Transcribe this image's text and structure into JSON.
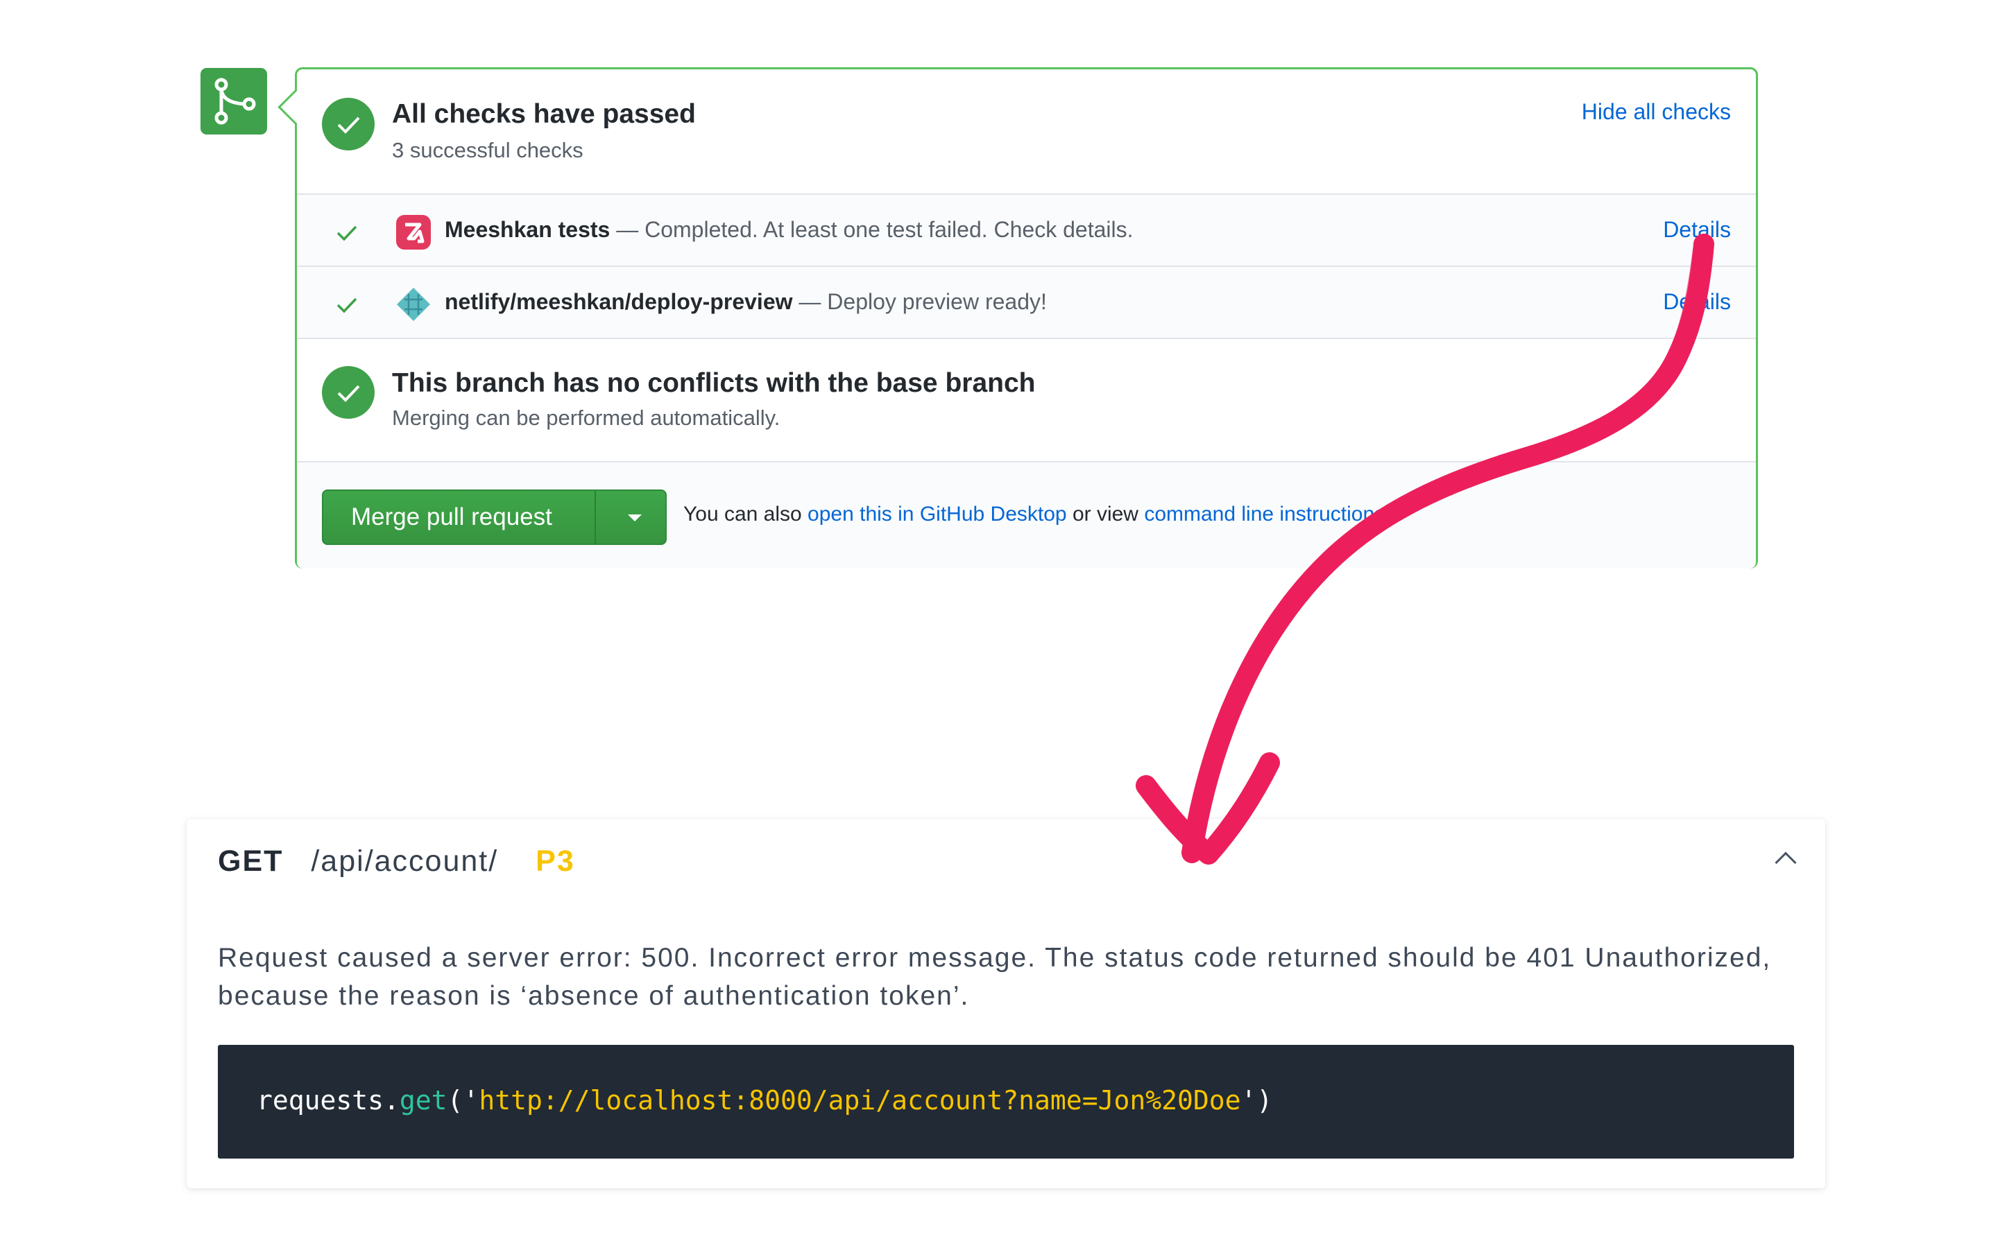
{
  "status_header": {
    "title": "All checks have passed",
    "subtitle": "3 successful checks",
    "hide_link": "Hide all checks"
  },
  "checks": [
    {
      "name": "Meeshkan tests",
      "description": "— Completed. At least one test failed. Check details.",
      "details_label": "Details",
      "logo_icon": "meeshkan-logo-icon"
    },
    {
      "name": "netlify/meeshkan/deploy-preview",
      "description": "— Deploy preview ready!",
      "details_label": "Details",
      "logo_icon": "netlify-logo-icon"
    }
  ],
  "conflicts": {
    "title": "This branch has no conflicts with the base branch",
    "subtitle": "Merging can be performed automatically."
  },
  "merge": {
    "button_label": "Merge pull request",
    "hint_prefix": "You can also",
    "desktop_link": "open this in GitHub Desktop",
    "hint_middle": "or view",
    "cli_link": "command line instructions."
  },
  "report_card": {
    "method": "GET",
    "path": "/api/account/",
    "priority": "P3",
    "description": "Request caused a server error: 500. Incorrect error message. The status code returned should be 401 Unauthorized, because the reason is ‘absence of authentication token’.",
    "code": {
      "object": "requests",
      "dot": ".",
      "function": "get",
      "open": "('",
      "url": "http://localhost:8000/api/account?name=Jon%20Doe",
      "close": "')"
    }
  },
  "colors": {
    "success_green": "#3fa14b",
    "border_green": "#59c25e",
    "link_blue": "#0366d6",
    "arrow_pink": "#ec1f5c",
    "priority_yellow": "#f7c400",
    "code_bg": "#222a35"
  }
}
